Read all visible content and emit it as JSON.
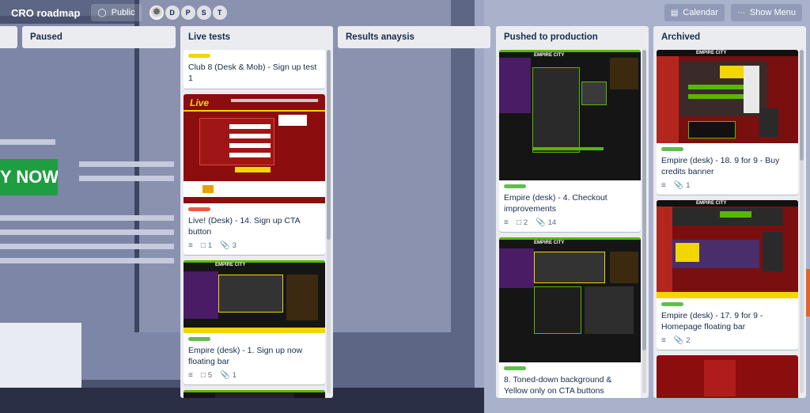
{
  "board": {
    "title": "CRO roadmap",
    "visibility": "Public",
    "visibility_icon": "globe-icon",
    "members": [
      "D",
      "P",
      "S",
      "T"
    ]
  },
  "header_right": {
    "calendar": "Calendar",
    "calendar_icon": "calendar-icon",
    "menu": "Show Menu",
    "menu_icon": "ellipsis-icon"
  },
  "background": {
    "cta_text": "Y NOW"
  },
  "colors": {
    "label_yellow": "#f2d600",
    "label_green": "#61bd4f",
    "label_red": "#eb5a46",
    "cta_green": "#1f9d41"
  },
  "lists": [
    {
      "name": "Paused"
    },
    {
      "name": "Live tests",
      "cards": [
        {
          "label": "yellow",
          "title": "Club 8 (Desk & Mob) - Sign up test 1"
        },
        {
          "label": "red",
          "title": "Live! (Desk) - 14. Sign up CTA button",
          "comments": "1",
          "attachments": "3",
          "cover": "Live"
        },
        {
          "label": "green",
          "title": "Empire (desk) - 1. Sign up now floating bar",
          "comments": "5",
          "attachments": "1",
          "cover": "EMPIRE CITY"
        }
      ]
    },
    {
      "name": "Results anaysis"
    },
    {
      "name": "Pushed to production",
      "cards": [
        {
          "label": "green",
          "title": "Empire (desk) - 4. Checkout improvements",
          "comments": "2",
          "attachments": "14",
          "cover": "EMPIRE CITY"
        },
        {
          "label": "green",
          "title": "8. Toned-down background & Yellow only on CTA buttons",
          "cover": "EMPIRE CITY"
        }
      ]
    },
    {
      "name": "Archived",
      "cards": [
        {
          "label": "green",
          "title": "Empire (desk) - 18. 9 for 9 - Buy credits banner",
          "attachments": "1",
          "cover": "EMPIRE CITY"
        },
        {
          "label": "green",
          "title": "Empire (desk) - 17. 9 for 9 - Homepage floating bar",
          "attachments": "2",
          "cover": "EMPIRE CITY"
        }
      ]
    }
  ]
}
